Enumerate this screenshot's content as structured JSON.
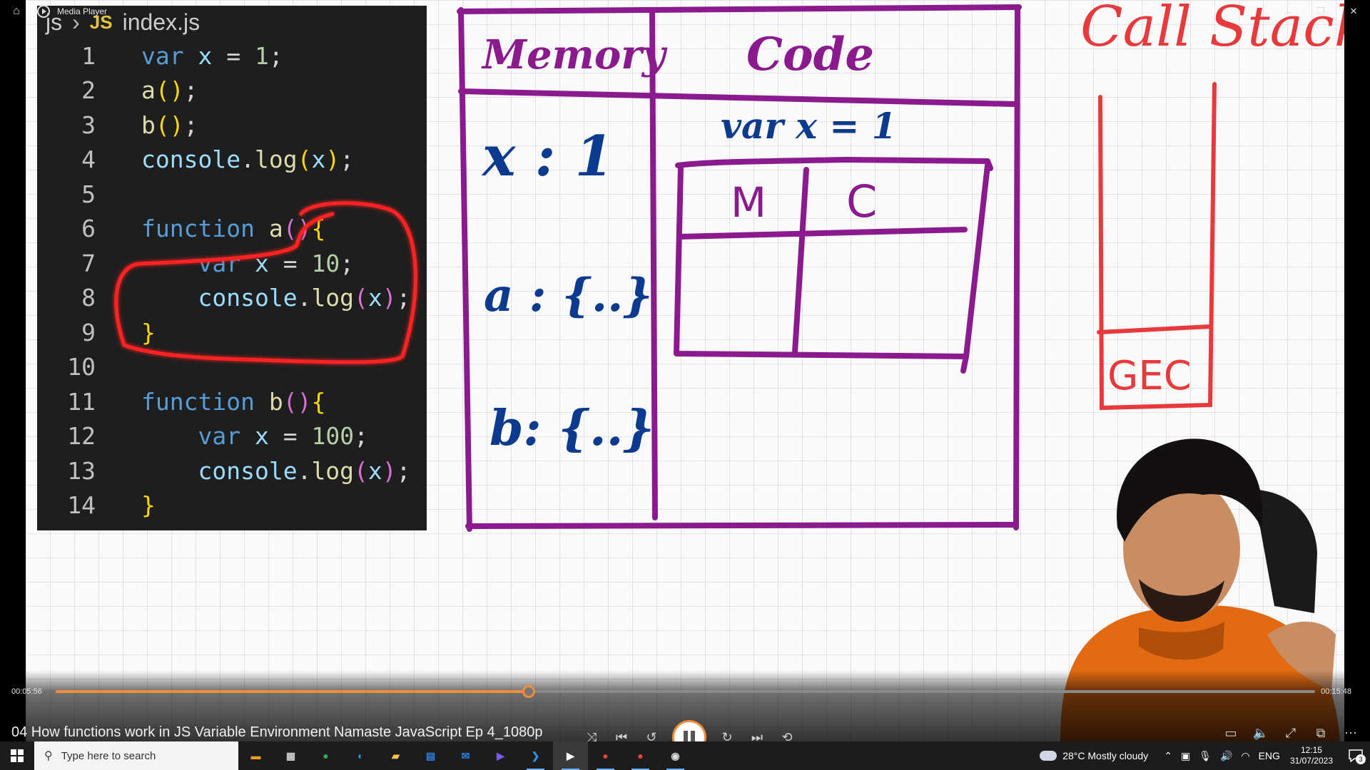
{
  "window": {
    "app_title": "Media Player"
  },
  "editor": {
    "breadcrumb_folder": "js",
    "breadcrumb_badge": "JS",
    "breadcrumb_file": "index.js",
    "lines": [
      {
        "n": "1"
      },
      {
        "n": "2"
      },
      {
        "n": "3"
      },
      {
        "n": "4"
      },
      {
        "n": "5"
      },
      {
        "n": "6"
      },
      {
        "n": "7"
      },
      {
        "n": "8"
      },
      {
        "n": "9"
      },
      {
        "n": "10"
      },
      {
        "n": "11"
      },
      {
        "n": "12"
      },
      {
        "n": "13"
      },
      {
        "n": "14"
      }
    ]
  },
  "whiteboard": {
    "memory_header": "Memory",
    "code_header": "Code",
    "memory_x": "x : 1",
    "memory_a": "a : {..}",
    "memory_b": "b: {..}",
    "code_line": "var x = 1",
    "inner_memory": "M",
    "inner_code": "C",
    "call_stack_title": "Call Stack",
    "gec_label": "GEC",
    "ink_purple": "#8b1a8e",
    "ink_blue": "#0b3a8f",
    "ink_red": "#e8393d"
  },
  "player": {
    "time_current": "00:05:56",
    "time_total": "00:15:48",
    "progress": 0.3755,
    "video_title": "04 How functions work in JS   Variable Environment  Namaste JavaScript Ep 4_1080p",
    "accent_color": "#f08c3a"
  },
  "taskbar": {
    "search_placeholder": "Type here to search",
    "apps": [
      {
        "name": "store-bag",
        "color": "#e8a020"
      },
      {
        "name": "task-view",
        "color": "#cccccc"
      },
      {
        "name": "chrome",
        "color": "#34a853"
      },
      {
        "name": "edge",
        "color": "#1ba1e2"
      },
      {
        "name": "file-explorer",
        "color": "#f5c542"
      },
      {
        "name": "microsoft-store",
        "color": "#2f7fe0"
      },
      {
        "name": "mail",
        "color": "#2a7de1"
      },
      {
        "name": "media-app",
        "color": "#7a5af8"
      },
      {
        "name": "vscode",
        "color": "#2d8fe0"
      },
      {
        "name": "media-player",
        "color": "#ffffff"
      },
      {
        "name": "chrome-profile-1",
        "color": "#ea4335"
      },
      {
        "name": "chrome-profile-2",
        "color": "#ea4335"
      },
      {
        "name": "obs",
        "color": "#dddddd"
      }
    ],
    "weather_text": "28°C  Mostly cloudy",
    "language": "ENG",
    "clock_time": "12:15",
    "clock_date": "31/07/2023",
    "notification_count": "3"
  }
}
